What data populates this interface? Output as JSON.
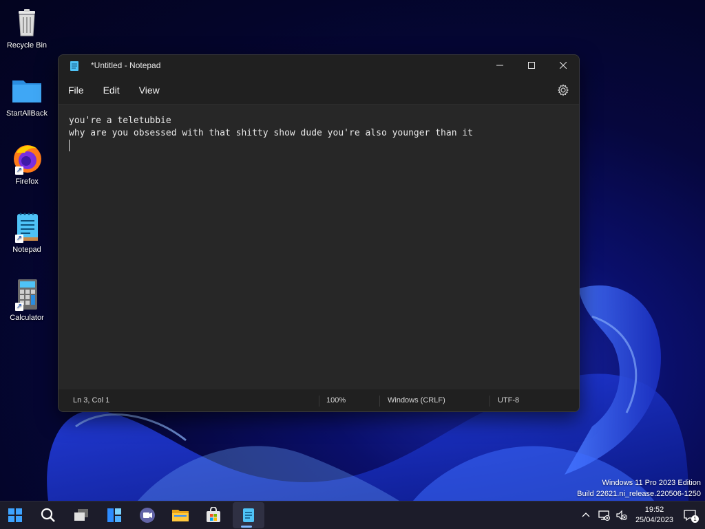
{
  "desktop": {
    "icons": [
      {
        "label": "Recycle Bin"
      },
      {
        "label": "StartAllBack"
      },
      {
        "label": "Firefox"
      },
      {
        "label": "Notepad"
      },
      {
        "label": "Calculator"
      }
    ]
  },
  "window": {
    "title": "*Untitled - Notepad",
    "menu": [
      "File",
      "Edit",
      "View"
    ],
    "editor_lines": [
      "you're a teletubbie",
      "why are you obsessed with that shitty show dude you're also younger than it",
      ""
    ],
    "status": {
      "position": "Ln 3, Col 1",
      "zoom": "100%",
      "line_ending": "Windows (CRLF)",
      "encoding": "UTF-8"
    }
  },
  "watermark": {
    "line1": "Windows 11 Pro 2023 Edition",
    "line2": "Build 22621.ni_release.220506-1250"
  },
  "taskbar": {
    "time": "19:52",
    "date": "25/04/2023",
    "notification_count": "1"
  },
  "colors": {
    "accent": "#7db8ff",
    "window_bg": "#202020",
    "editor_bg": "#272727"
  }
}
